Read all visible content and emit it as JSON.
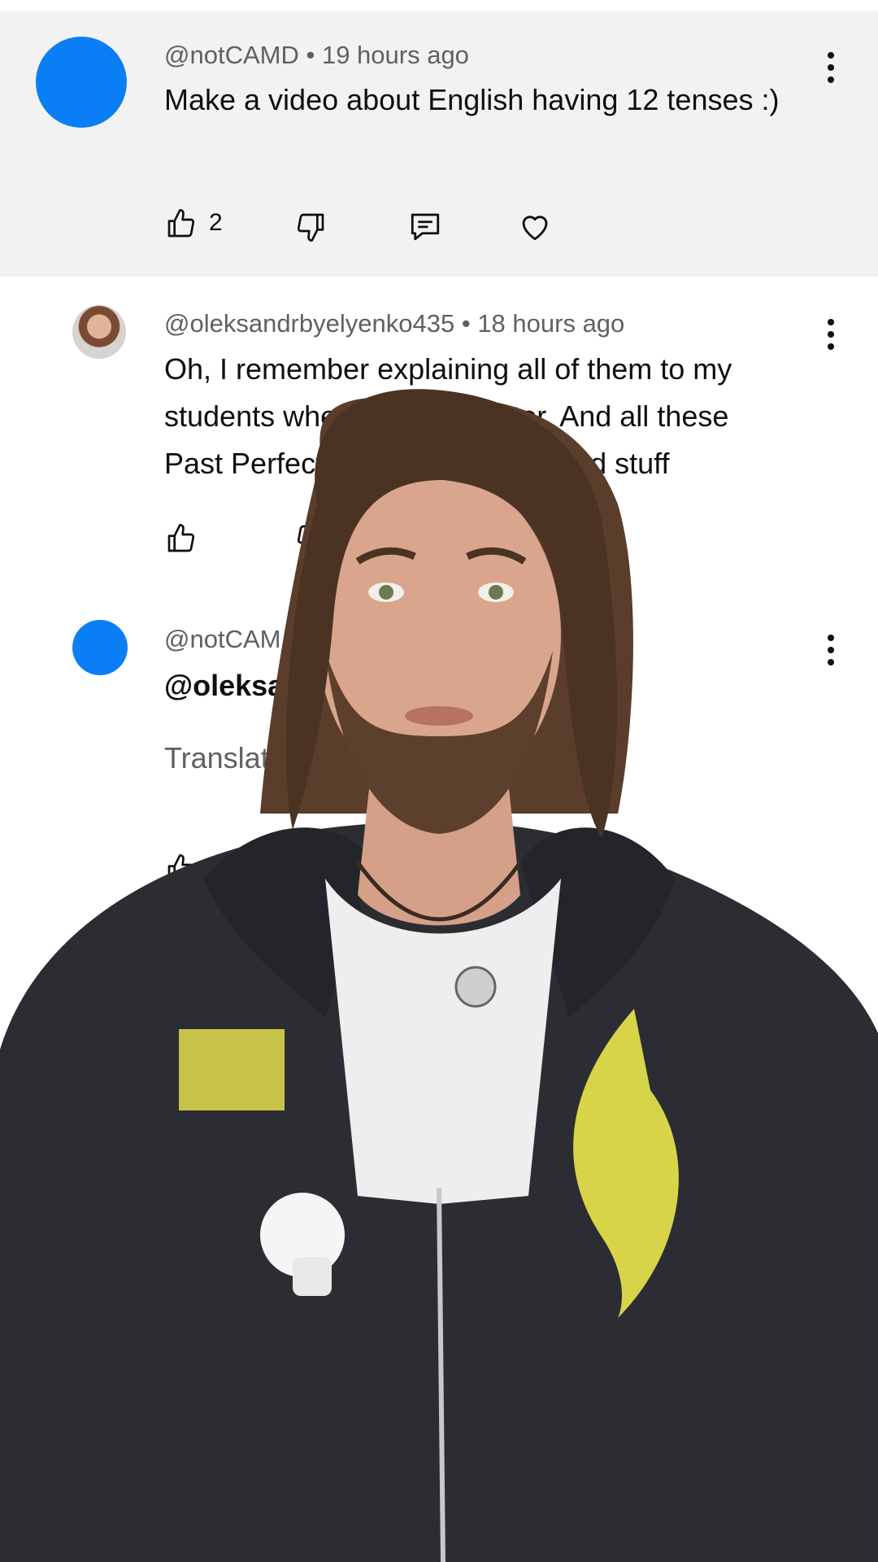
{
  "comments": [
    {
      "author": "@notCAMD",
      "time": "19 hours ago",
      "text": "Make a video about English having 12 tenses :)",
      "likes": "2",
      "icons": [
        "thumbs-up-icon",
        "thumbs-down-icon",
        "reply-icon",
        "heart-icon",
        "more-vert-icon"
      ]
    },
    {
      "author": "@oleksandrbyelyenko435",
      "time": "18 hours ago",
      "text_line1": "Oh, I remember explaining all of them to my",
      "text_line2_a": "students when I wa",
      "text_line2_b": "tor. And all these",
      "text_line3_a": "Past Perfect",
      "text_line3_b": "icked stuff"
    },
    {
      "author_partial": "@notCAM",
      "mention_partial": "@oleksa",
      "translate_partial": "Translate to"
    }
  ],
  "separator": "•",
  "colors": {
    "avatar": "#0a7ff5",
    "highlight_bg": "#f2f2f2",
    "meta": "#606060"
  }
}
